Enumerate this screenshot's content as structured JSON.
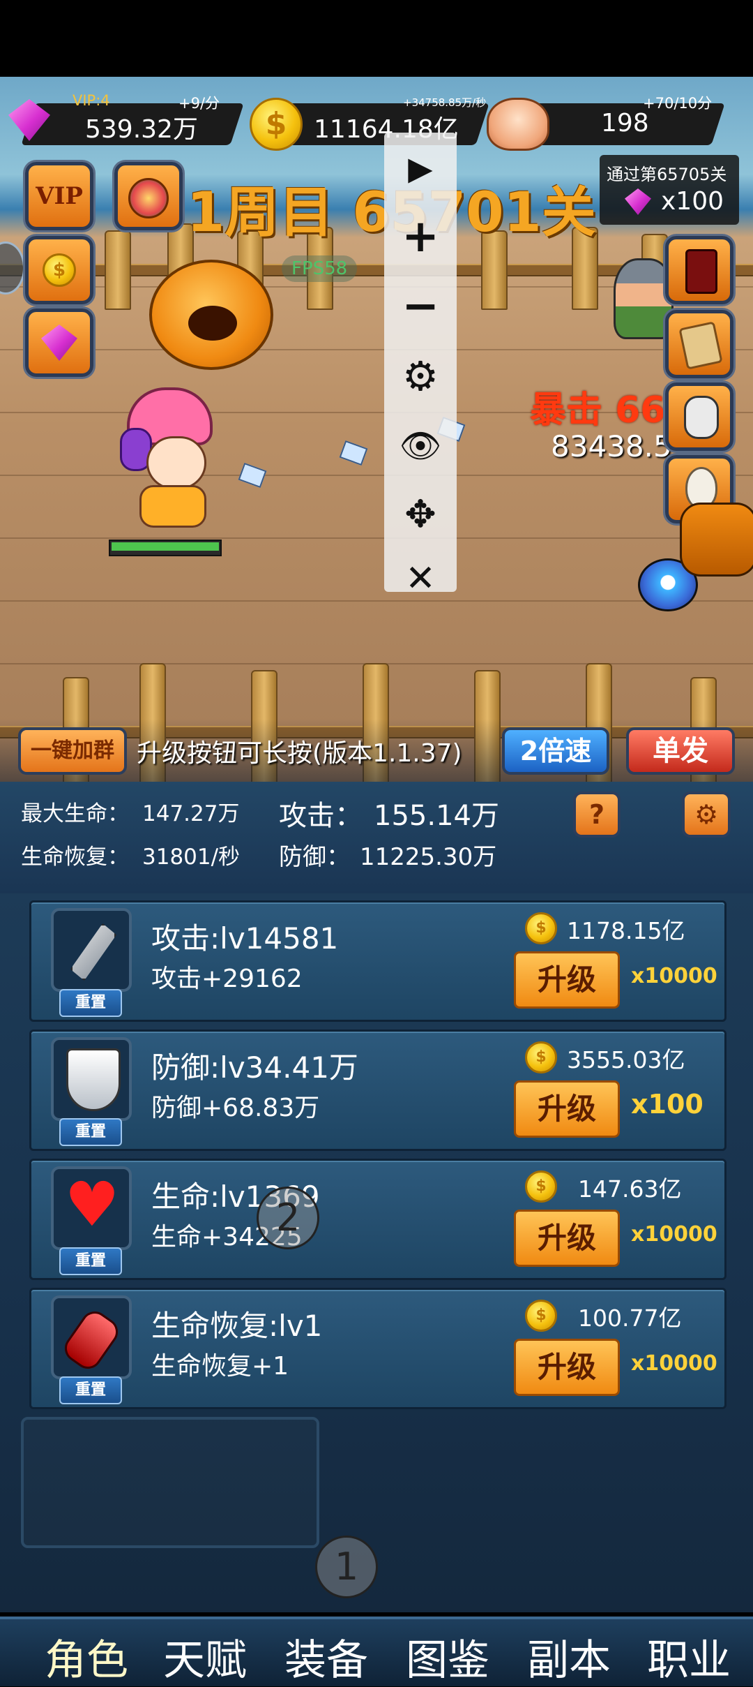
{
  "resources": {
    "gems": {
      "vip": "VIP:4",
      "rate": "+9/分",
      "value": "539.32万"
    },
    "coins": {
      "rate": "+34758.85万/秒",
      "value": "11164.18亿"
    },
    "skulls": {
      "rate": "+70/10分",
      "value": "198"
    }
  },
  "reward": {
    "label": "通过第65705关",
    "amount": "x100"
  },
  "stage": {
    "title": "1周目 65701关",
    "fps": "FPS58"
  },
  "side_left": {
    "vip_label": "VIP"
  },
  "battle": {
    "crit_text": "暴击 66",
    "damage": "83438.5"
  },
  "toolbar": {
    "play": "▶",
    "plus": "+",
    "minus": "−",
    "settings": "⚙",
    "hide": "👁",
    "move": "✥",
    "close": "✕"
  },
  "controls": {
    "join_group": "一键加群",
    "notice": "升级按钮可长按(版本1.1.37)",
    "speed": "2倍速",
    "single": "单发"
  },
  "stats": {
    "max_hp_label": "最大生命：",
    "max_hp": "147.27万",
    "attack_label": "攻击：",
    "attack": "155.14万",
    "regen_label": "生命恢复：",
    "regen": "31801/秒",
    "defense_label": "防御：",
    "defense": "11225.30万",
    "help": "?"
  },
  "upgrades": [
    {
      "title": "攻击:lv14581",
      "effect": "攻击+29162",
      "cost": "1178.15亿",
      "button": "升级",
      "multiplier": "x10000",
      "reset": "重置"
    },
    {
      "title": "防御:lv34.41万",
      "effect": "防御+68.83万",
      "cost": "3555.03亿",
      "button": "升级",
      "multiplier": "x100",
      "reset": "重置"
    },
    {
      "title": "生命:lv1369",
      "effect": "生命+34225",
      "cost": "147.63亿",
      "button": "升级",
      "multiplier": "x10000",
      "reset": "重置"
    },
    {
      "title": "生命恢复:lv1",
      "effect": "生命恢复+1",
      "cost": "100.77亿",
      "button": "升级",
      "multiplier": "x10000",
      "reset": "重置"
    }
  ],
  "markers": {
    "one": "1",
    "two": "2"
  },
  "nav": [
    "角色",
    "天赋",
    "装备",
    "图鉴",
    "副本",
    "职业"
  ],
  "colors": {
    "accent_orange": "#f08a12",
    "panel_blue": "#1e4563",
    "stage_title": "#f5a623",
    "multiplier_yellow": "#ffd23a"
  }
}
